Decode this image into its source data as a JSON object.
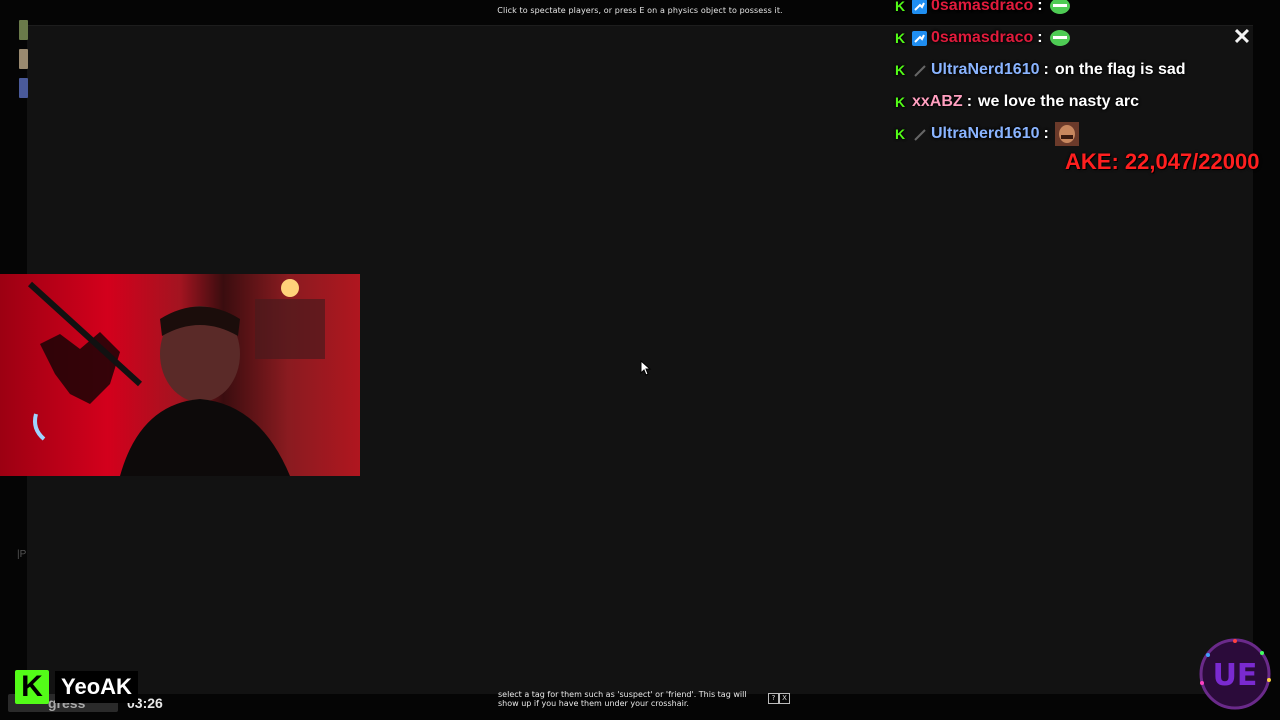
{
  "hud": {
    "top_hint": "Click to spectate players, or press E on a physics object to possess it.",
    "bottom_hint": "select a tag for them such as 'suspect' or 'friend'. This tag will show up if you have them under your crosshair.",
    "bottom_keys": [
      "?",
      "X"
    ],
    "left_tag": "|P",
    "progress_label": "gress",
    "timer": "03:26",
    "close_label": "✕"
  },
  "chat": {
    "messages": [
      {
        "user": "0samasdraco",
        "user_color": "#e01b3c",
        "badges": [
          "kick",
          "sub"
        ],
        "sep": ":",
        "text": "",
        "emote": "green-face"
      },
      {
        "user": "0samasdraco",
        "user_color": "#e01b3c",
        "badges": [
          "kick",
          "sub"
        ],
        "sep": ":",
        "text": "",
        "emote": "green-face"
      },
      {
        "user": "UltraNerd1610",
        "user_color": "#8ab4ff",
        "badges": [
          "kick",
          "sword"
        ],
        "sep": ":",
        "text": "on the flag is sad",
        "emote": ""
      },
      {
        "user": "xxABZ",
        "user_color": "#ff9fbf",
        "badges": [
          "kick"
        ],
        "sep": ":",
        "text": "we love the nasty arc",
        "emote": ""
      },
      {
        "user": "UltraNerd1610",
        "user_color": "#8ab4ff",
        "badges": [
          "kick",
          "sword"
        ],
        "sep": ":",
        "text": "",
        "emote": "face-photo"
      }
    ]
  },
  "overlay": {
    "counter_text": "AKE: 22,047/22000",
    "color": "#ff1f1f"
  },
  "streamer": {
    "platform_letter": "K",
    "name": "YeoAK",
    "accent": "#53fc18"
  },
  "logo": {
    "text": "UE"
  }
}
